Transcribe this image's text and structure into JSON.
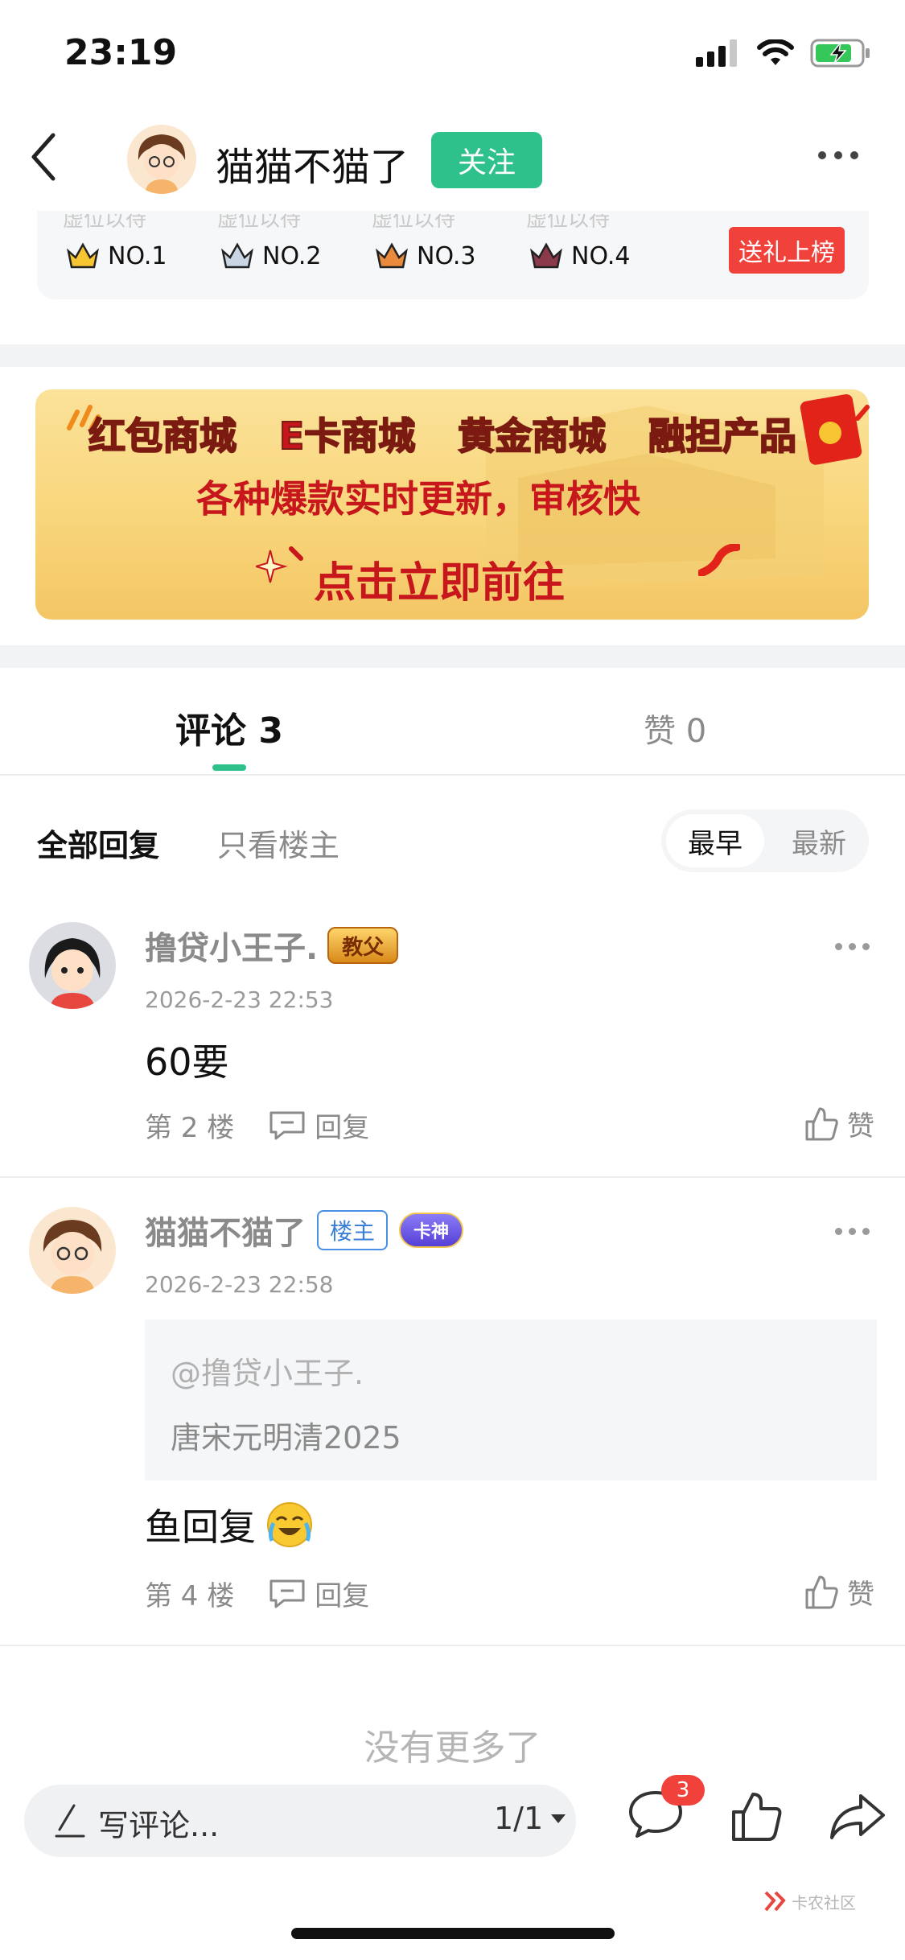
{
  "status_bar": {
    "time": "23:19"
  },
  "header": {
    "name": "猫猫不猫了",
    "follow_label": "关注"
  },
  "rank": {
    "items": [
      {
        "sub": "虚位以待",
        "label": "NO.1"
      },
      {
        "sub": "虚位以待",
        "label": "NO.2"
      },
      {
        "sub": "虚位以待",
        "label": "NO.3"
      },
      {
        "sub": "虚位以待",
        "label": "NO.4"
      }
    ],
    "gift_label": "送礼上榜"
  },
  "banner": {
    "row1": [
      "红包商城",
      "E卡商城",
      "黄金商城",
      "融担产品"
    ],
    "row2": "各种爆款实时更新，审核快",
    "row3": "点击立即前往"
  },
  "tabs": {
    "comments": "评论 3",
    "likes": "赞 0"
  },
  "filters": {
    "all": "全部回复",
    "owner_only": "只看楼主",
    "sort_early": "最早",
    "sort_new": "最新"
  },
  "comments": [
    {
      "name": "撸贷小王子.",
      "badge": "教父",
      "time": "2026-2-23 22:53",
      "body": "60要",
      "floor": "第 2 楼",
      "reply_label": "回复",
      "like_label": "赞"
    },
    {
      "name": "猫猫不猫了",
      "owner_badge": "楼主",
      "badge": "卡神",
      "time": "2026-2-23 22:58",
      "quote_at": "@撸贷小王子.",
      "quote_text": "唐宋元明清2025",
      "body": "鱼回复",
      "floor": "第 4 楼",
      "reply_label": "回复",
      "like_label": "赞"
    }
  ],
  "no_more": "没有更多了",
  "bottom_bar": {
    "write_placeholder": "写评论...",
    "page": "1/1",
    "comment_count": "3"
  },
  "watermark": "卡农社区",
  "colors": {
    "accent": "#2fc18c",
    "red": "#f0413b"
  }
}
